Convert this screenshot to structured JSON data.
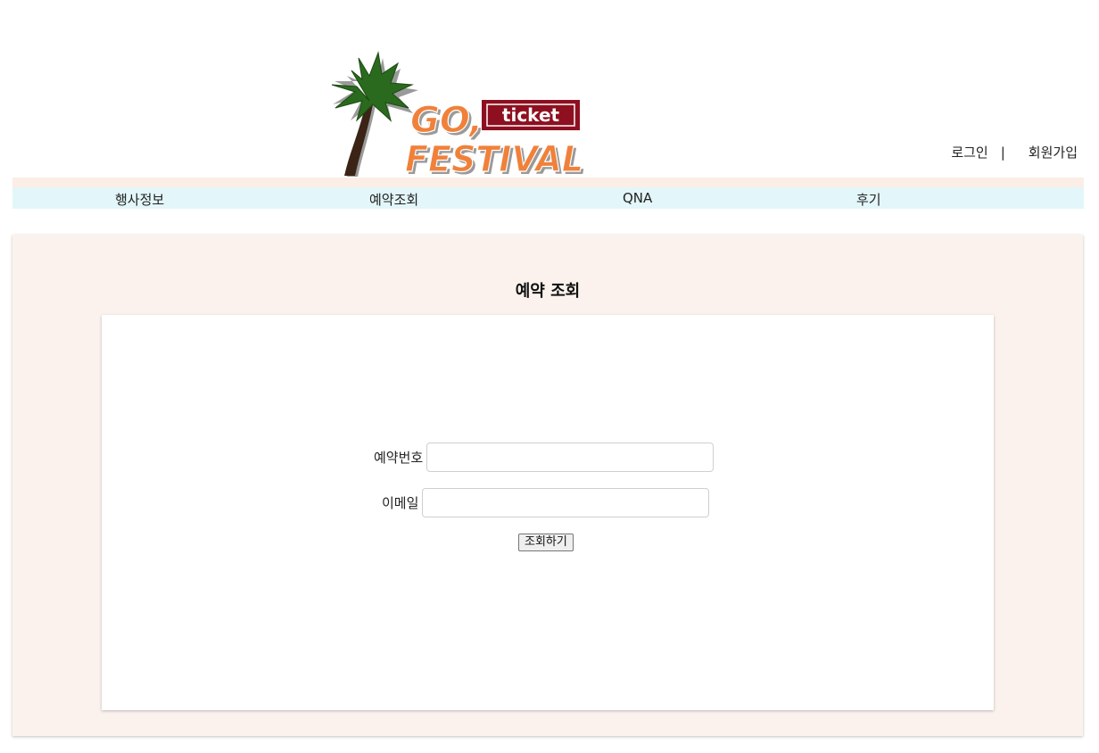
{
  "header": {
    "logo": {
      "line1": "GO,",
      "badge": "ticket",
      "line2": "FESTIVAL"
    },
    "auth": {
      "login": "로그인",
      "separator": "|",
      "signup": "회원가입"
    }
  },
  "nav": {
    "items": [
      {
        "label": "행사정보"
      },
      {
        "label": "예약조회"
      },
      {
        "label": "QNA"
      },
      {
        "label": "후기"
      }
    ]
  },
  "main": {
    "title": "예약 조회",
    "form": {
      "reservation_label": "예약번호",
      "reservation_value": "",
      "email_label": "이메일",
      "email_value": "",
      "submit_label": "조회하기"
    }
  },
  "colors": {
    "nav_top": "#fbeee6",
    "nav_bar": "#e3f6fa",
    "panel_bg": "#fbf2ee",
    "logo_orange": "#f0813a",
    "logo_red": "#8e1020",
    "palm_green": "#2a6a1e",
    "trunk_brown": "#3b2416"
  }
}
